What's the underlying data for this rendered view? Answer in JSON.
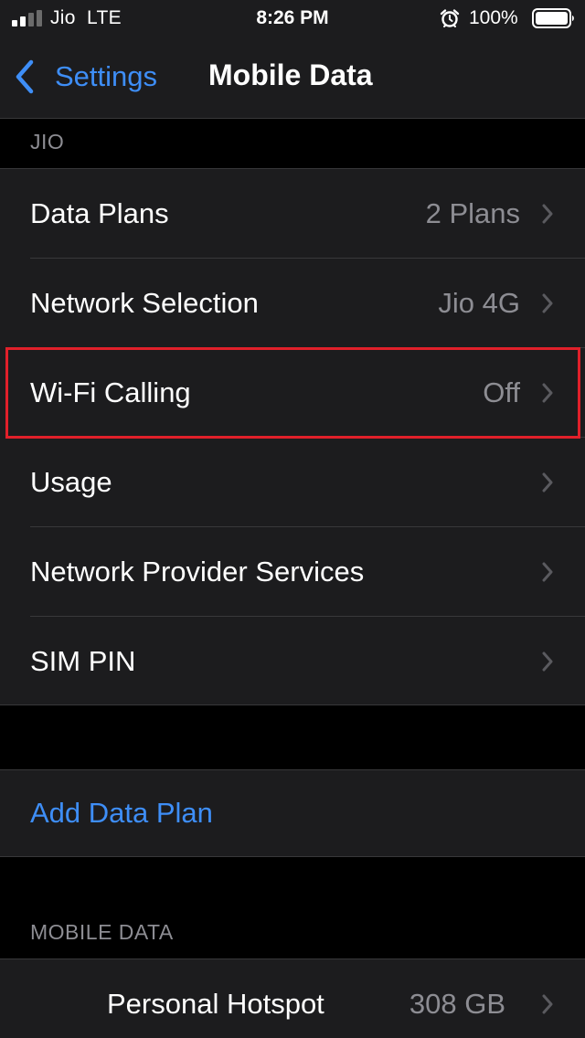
{
  "status_bar": {
    "carrier": "Jio",
    "network": "LTE",
    "time": "8:26 PM",
    "battery": "100%",
    "signal_bars_filled": 2,
    "signal_bars_total": 4
  },
  "nav": {
    "back_label": "Settings",
    "title": "Mobile Data"
  },
  "sections": {
    "carrier_header": "JIO",
    "mobile_data_header": "MOBILE DATA"
  },
  "carrier_rows": [
    {
      "label": "Data Plans",
      "value": "2 Plans"
    },
    {
      "label": "Network Selection",
      "value": "Jio 4G"
    },
    {
      "label": "Wi-Fi Calling",
      "value": "Off"
    },
    {
      "label": "Usage",
      "value": ""
    },
    {
      "label": "Network Provider Services",
      "value": ""
    },
    {
      "label": "SIM PIN",
      "value": ""
    }
  ],
  "add_plan": {
    "label": "Add Data Plan"
  },
  "mobile_data_rows": [
    {
      "label": "Personal Hotspot",
      "value": "308 GB"
    }
  ],
  "colors": {
    "accent": "#3e8ef7",
    "background": "#000000",
    "cell": "#1c1c1e",
    "secondary_text": "#8d8d93",
    "highlight": "#e0202a"
  }
}
